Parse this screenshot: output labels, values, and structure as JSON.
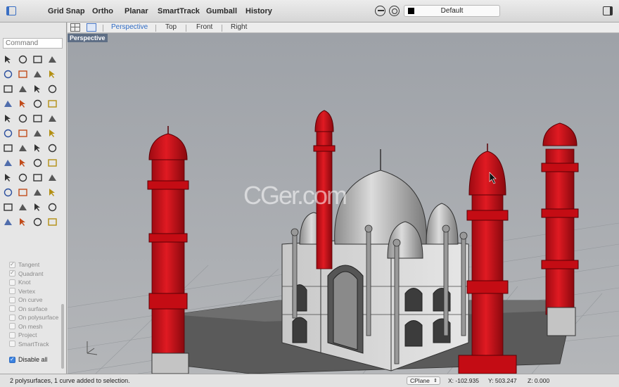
{
  "toolbar": {
    "modes": [
      "Grid Snap",
      "Ortho",
      "Planar",
      "SmartTrack",
      "Gumball",
      "History"
    ],
    "layer": "Default",
    "layer_color": "#000000"
  },
  "command": {
    "placeholder": "Command"
  },
  "osnaps": [
    {
      "label": "Tangent",
      "checked": true
    },
    {
      "label": "Quadrant",
      "checked": true
    },
    {
      "label": "Knot",
      "checked": false
    },
    {
      "label": "Vertex",
      "checked": false
    },
    {
      "label": "On curve",
      "checked": false
    },
    {
      "label": "On surface",
      "checked": false
    },
    {
      "label": "On polysurface",
      "checked": false
    },
    {
      "label": "On mesh",
      "checked": false
    },
    {
      "label": "Project",
      "checked": false
    },
    {
      "label": "SmartTrack",
      "checked": false
    }
  ],
  "disable_all": "Disable all",
  "viewport_tabs": [
    "Perspective",
    "Top",
    "Front",
    "Right"
  ],
  "viewport_label": "Perspective",
  "watermark": "CGer.com",
  "status": {
    "message": "2 polysurfaces, 1 curve added to selection.",
    "cplane": "CPlane",
    "x": "X: -102.935",
    "y": "Y: 503.247",
    "z": "Z: 0.000"
  },
  "colors": {
    "selection_red": "#d0101a",
    "viewport_bg": "#a8abb0",
    "accent": "#2e6bc5"
  }
}
